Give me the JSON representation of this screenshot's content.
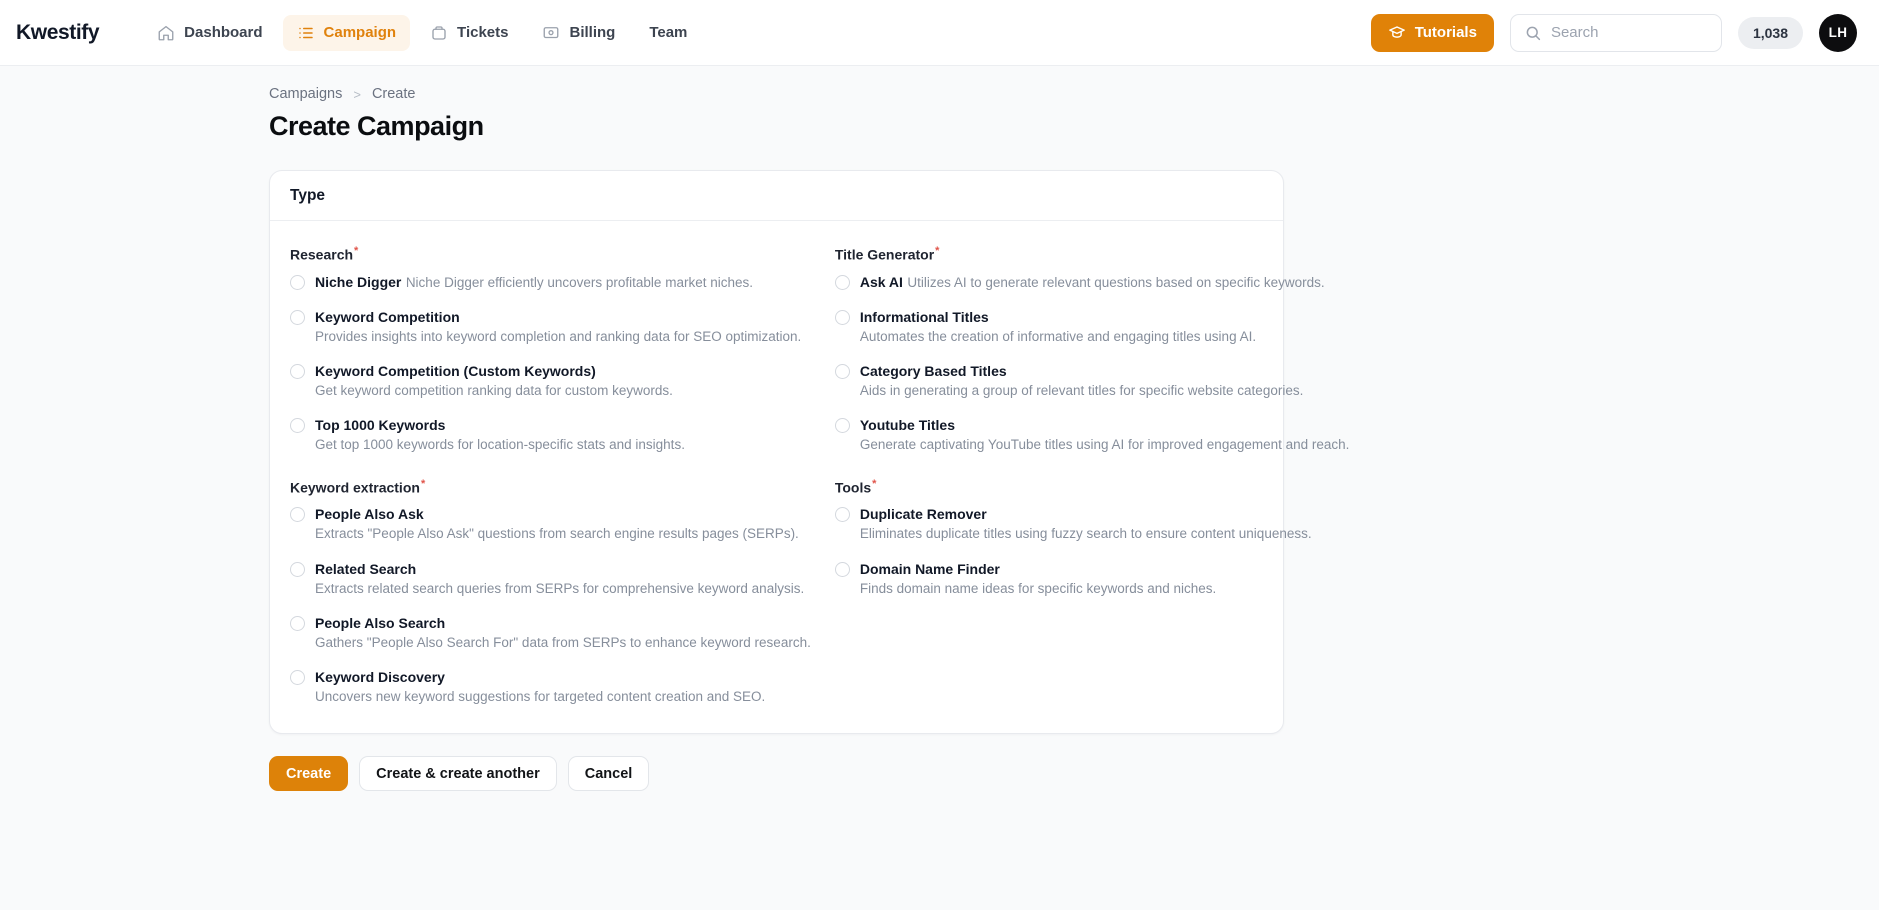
{
  "header": {
    "brand": "Kwestify",
    "nav": [
      {
        "label": "Dashboard",
        "icon": "home-icon",
        "active": false
      },
      {
        "label": "Campaign",
        "icon": "list-icon",
        "active": true
      },
      {
        "label": "Tickets",
        "icon": "ticket-icon",
        "active": false
      },
      {
        "label": "Billing",
        "icon": "billing-icon",
        "active": false
      },
      {
        "label": "Team",
        "icon": "",
        "active": false
      }
    ],
    "tutorials_label": "Tutorials",
    "tutorials_icon": "graduation-cap-icon",
    "search": {
      "value": "",
      "placeholder": "Search",
      "icon": "search-icon"
    },
    "credits": "1,038",
    "avatar_initials": "LH"
  },
  "breadcrumb": {
    "parent": "Campaigns",
    "separator": ">",
    "current": "Create"
  },
  "page_title": "Create Campaign",
  "card": {
    "title": "Type",
    "required_marker": "*",
    "columns": [
      {
        "groups": [
          {
            "label": "Research",
            "options": [
              {
                "title": "Niche Digger",
                "desc": "Niche Digger efficiently uncovers profitable market niches."
              },
              {
                "title": "Keyword Competition",
                "desc": "Provides insights into keyword completion and ranking data for SEO optimization."
              },
              {
                "title": "Keyword Competition (Custom Keywords)",
                "desc": "Get keyword competition ranking data for custom keywords."
              },
              {
                "title": "Top 1000 Keywords",
                "desc": "Get top 1000 keywords for location-specific stats and insights."
              }
            ]
          },
          {
            "label": "Keyword extraction",
            "options": [
              {
                "title": "People Also Ask",
                "desc": "Extracts \"People Also Ask\" questions from search engine results pages (SERPs)."
              },
              {
                "title": "Related Search",
                "desc": "Extracts related search queries from SERPs for comprehensive keyword analysis."
              },
              {
                "title": "People Also Search",
                "desc": "Gathers \"People Also Search For\" data from SERPs to enhance keyword research."
              },
              {
                "title": "Keyword Discovery",
                "desc": "Uncovers new keyword suggestions for targeted content creation and SEO."
              }
            ]
          }
        ]
      },
      {
        "groups": [
          {
            "label": "Title Generator",
            "options": [
              {
                "title": "Ask AI",
                "desc": "Utilizes AI to generate relevant questions based on specific keywords."
              },
              {
                "title": "Informational Titles",
                "desc": "Automates the creation of informative and engaging titles using AI."
              },
              {
                "title": "Category Based Titles",
                "desc": "Aids in generating a group of relevant titles for specific website categories."
              },
              {
                "title": "Youtube Titles",
                "desc": "Generate captivating YouTube titles using AI for improved engagement and reach."
              }
            ]
          },
          {
            "label": "Tools",
            "options": [
              {
                "title": "Duplicate Remover",
                "desc": "Eliminates duplicate titles using fuzzy search to ensure content uniqueness."
              },
              {
                "title": "Domain Name Finder",
                "desc": "Finds domain name ideas for specific keywords and niches."
              }
            ]
          }
        ]
      }
    ]
  },
  "actions": {
    "create": "Create",
    "create_another": "Create & create another",
    "cancel": "Cancel"
  },
  "colors": {
    "accent": "#e08208",
    "required": "#e0544a",
    "nav_active_bg": "#fdf4e9"
  }
}
